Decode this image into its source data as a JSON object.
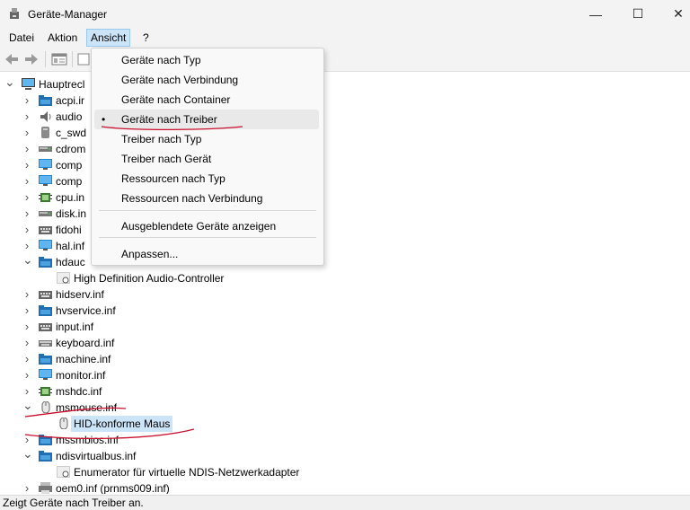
{
  "window": {
    "title": "Geräte-Manager",
    "controls": {
      "minimize": "—",
      "maximize": "☐",
      "close": "✕"
    }
  },
  "menubar": {
    "items": [
      "Datei",
      "Aktion",
      "Ansicht",
      "?"
    ]
  },
  "toolbar": {
    "icons": [
      "back-arrow-icon",
      "forward-arrow-icon",
      "properties-icon",
      "view-icon"
    ]
  },
  "tree": {
    "root": "Hauptrechner",
    "root_partial": "Hauptrecl",
    "items": [
      {
        "label": "acpi.ir",
        "icon": "folder-icon"
      },
      {
        "label": "audio",
        "icon": "speaker-icon"
      },
      {
        "label": "c_swd",
        "icon": "storage-icon"
      },
      {
        "label": "cdrom",
        "icon": "drive-icon"
      },
      {
        "label": "comp",
        "icon": "monitor-icon"
      },
      {
        "label": "comp",
        "icon": "monitor-icon"
      },
      {
        "label": "cpu.in",
        "icon": "chip-icon"
      },
      {
        "label": "disk.in",
        "icon": "drive-icon"
      },
      {
        "label": "fidohi",
        "icon": "hid-icon"
      },
      {
        "label": "hal.inf",
        "icon": "monitor-icon"
      },
      {
        "label": "hdauc",
        "icon": "folder-icon",
        "expanded": true
      },
      {
        "label": "High Definition Audio-Controller",
        "icon": "device-icon",
        "child": true
      },
      {
        "label": "hidserv.inf",
        "icon": "hid-icon"
      },
      {
        "label": "hvservice.inf",
        "icon": "folder-icon"
      },
      {
        "label": "input.inf",
        "icon": "hid-icon"
      },
      {
        "label": "keyboard.inf",
        "icon": "keyboard-icon"
      },
      {
        "label": "machine.inf",
        "icon": "folder-icon"
      },
      {
        "label": "monitor.inf",
        "icon": "monitor-icon"
      },
      {
        "label": "mshdc.inf",
        "icon": "chip-icon"
      },
      {
        "label": "msmouse.inf",
        "icon": "mouse-icon",
        "expanded": true
      },
      {
        "label": "HID-konforme Maus",
        "icon": "mouse-icon",
        "child": true,
        "selected": true
      },
      {
        "label": "mssmbios.inf",
        "icon": "folder-icon"
      },
      {
        "label": "ndisvirtualbus.inf",
        "icon": "folder-icon",
        "expanded": true
      },
      {
        "label": "Enumerator für virtuelle NDIS-Netzwerkadapter",
        "icon": "device-icon",
        "child": true
      },
      {
        "label": "oem0.inf (prnms009.inf)",
        "icon": "printer-icon"
      }
    ]
  },
  "dropdown": {
    "items": [
      {
        "label": "Geräte nach Typ"
      },
      {
        "label": "Geräte nach Verbindung"
      },
      {
        "label": "Geräte nach Container"
      },
      {
        "label": "Geräte nach Treiber",
        "checked": true,
        "bullet": "•"
      },
      {
        "label": "Treiber nach Typ"
      },
      {
        "label": "Treiber nach Gerät"
      },
      {
        "label": "Ressourcen nach Typ"
      },
      {
        "label": "Ressourcen nach Verbindung"
      },
      {
        "label": "Ausgeblendete Geräte anzeigen"
      },
      {
        "label": "Anpassen..."
      }
    ]
  },
  "statusbar": {
    "text": "Zeigt Geräte nach Treiber an."
  },
  "colors": {
    "highlight": "#cce4f7",
    "ink": "#c8102e",
    "accent": "#0067c0"
  }
}
